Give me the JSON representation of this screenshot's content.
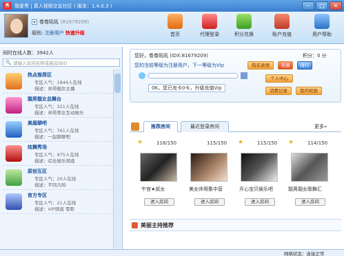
{
  "window": {
    "title": "我爱秀 | 真人视频交友社区 ( 版本：1.4.0.3 )",
    "logo": "秀",
    "min": "–",
    "max": "□",
    "close": "✕"
  },
  "user": {
    "nick": "卷卷吼吼",
    "id": "(81679209)",
    "level_label": "级别:",
    "level": "注册用户",
    "upgrade": "快速升级"
  },
  "nav": [
    {
      "label": "首页"
    },
    {
      "label": "代理登录"
    },
    {
      "label": "积分兑换"
    },
    {
      "label": "账户充值"
    },
    {
      "label": "用户帮助"
    }
  ],
  "sidebar": {
    "online": "同时在线人数：3942人",
    "search_placeholder": "请输入房间名称或者房间ID",
    "rooms": [
      {
        "name": "热点推荐区",
        "pop": "专区人气：1844人在线",
        "desc": "描述：帅哥靓女主播",
        "icon": "hot-icon"
      },
      {
        "name": "靓男靓女总舞台",
        "pop": "专区人气：321人在线",
        "desc": "描述：帅哥美女互动娱乐",
        "icon": "stage-icon"
      },
      {
        "name": "美眉聊吧",
        "pop": "专区人气：761人在线",
        "desc": "描述：一起聊聊吧",
        "icon": "chat-icon"
      },
      {
        "name": "炫舞秀场",
        "pop": "专区人气：975人在线",
        "desc": "描述：综合娱乐频道",
        "icon": "dance-icon"
      },
      {
        "name": "原创互区",
        "pop": "专区人气：20人在线",
        "desc": "描述：不同凡响",
        "icon": "original-icon"
      },
      {
        "name": "官方专区",
        "pop": "专区人气：21人在线",
        "desc": "描述：VIP频道 零距",
        "icon": "official-icon"
      }
    ]
  },
  "info": {
    "greeting": "您好，卷卷吼吼 (IDX:81679209)",
    "level_line": "您的当前等级为注册用户，下一等级为Vip",
    "score": "积分：0 分",
    "buy": "购买表情",
    "recharge": "充值",
    "rank": "排行",
    "personal": "个人中心",
    "records": "消费记录",
    "rights": "我的权限",
    "progress_label": "0K，您已充卡0卡，升级充值Vip",
    "progress_fraction": 0
  },
  "tabs": {
    "recommended": "推荐房间",
    "recent": "最近登录房间",
    "more": "更多»"
  },
  "cards": [
    {
      "count": "118/150",
      "name": "午宫★叔女",
      "enter": "进入房间"
    },
    {
      "count": "115/150",
      "name": "美女帅哥集中营",
      "enter": "进入房间"
    },
    {
      "count": "115/150",
      "name": "开心宝贝娱乐吧",
      "enter": "进入房间"
    },
    {
      "count": "114/150",
      "name": "靓男靓女歌舞汇",
      "enter": "进入房间"
    }
  ],
  "anchor": {
    "title": "美丽主持推荐"
  },
  "status": {
    "text": "网络状态：连接正常"
  },
  "colors": {
    "accent": "#3b7fd0",
    "warn": "#e00000",
    "button": "#f2a33a"
  }
}
